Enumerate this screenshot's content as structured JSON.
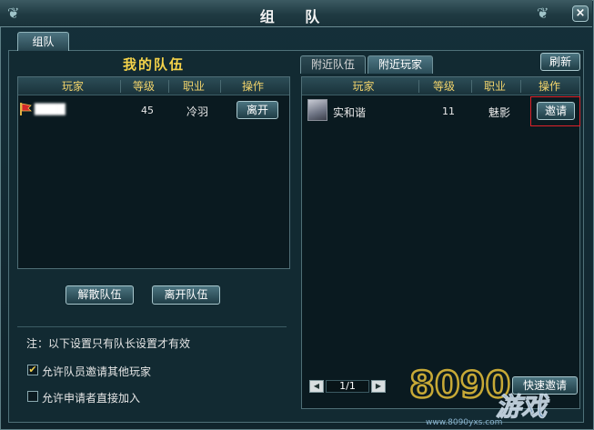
{
  "window": {
    "title": "组 队",
    "close_label": "×"
  },
  "tabs": {
    "team": "组队"
  },
  "my_team": {
    "title": "我的队伍",
    "columns": [
      "玩家",
      "等级",
      "职业",
      "操作"
    ],
    "rows": [
      {
        "player": "████",
        "level": "45",
        "class": "冷羽",
        "action": "离开"
      }
    ],
    "disband_label": "解散队伍",
    "leave_label": "离开队伍"
  },
  "settings": {
    "note": "注：以下设置只有队长设置才有效",
    "options": [
      {
        "label": "允许队员邀请其他玩家",
        "checked": true,
        "mark": "✔"
      },
      {
        "label": "允许申请者直接加入",
        "checked": false,
        "mark": ""
      }
    ]
  },
  "nearby": {
    "tabs": [
      "附近队伍",
      "附近玩家"
    ],
    "active_tab": "附近玩家",
    "refresh_label": "刷新",
    "columns": [
      "玩家",
      "等级",
      "职业",
      "操作"
    ],
    "rows": [
      {
        "player": "实和谐",
        "level": "11",
        "class": "魅影",
        "action": "邀请"
      }
    ],
    "pager": {
      "text": "1/1",
      "prev": "◀",
      "next": "▶"
    },
    "quick_invite_label": "快速邀请"
  },
  "watermark": {
    "brand": "8090",
    "site": "www.8090yxs.com",
    "tagline": "游戏"
  },
  "colors": {
    "accent_gold": "#f5d34a",
    "highlight_red": "#e0222a",
    "panel_bg": "#0a1a20"
  }
}
